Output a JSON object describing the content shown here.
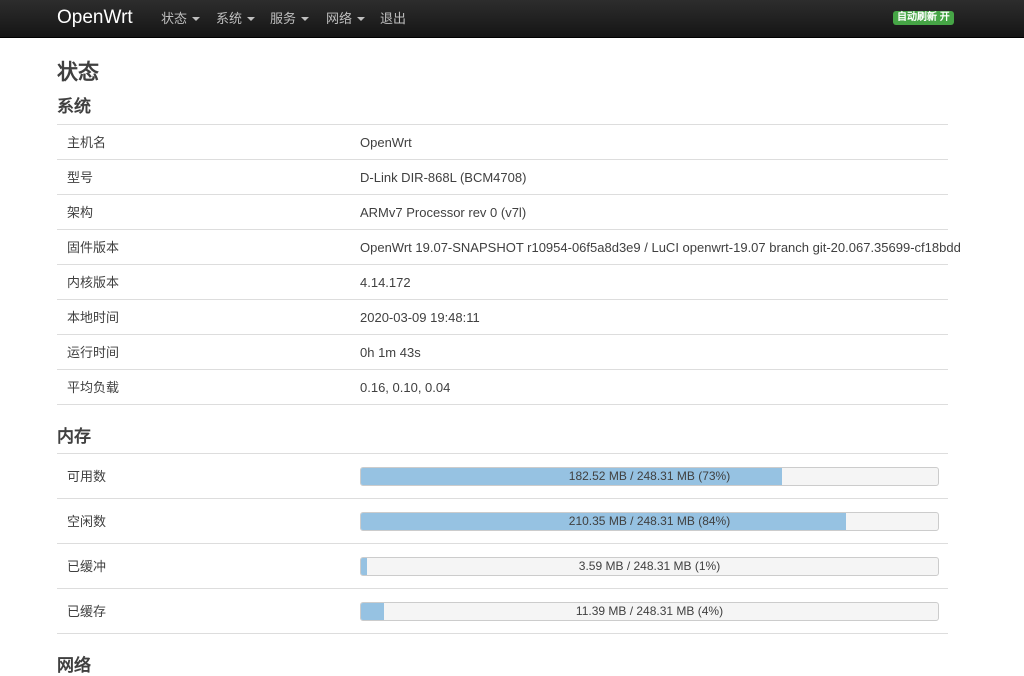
{
  "navbar": {
    "brand": "OpenWrt",
    "menu": [
      {
        "label": "状态",
        "dropdown": true
      },
      {
        "label": "系统",
        "dropdown": true
      },
      {
        "label": "服务",
        "dropdown": true
      },
      {
        "label": "网络",
        "dropdown": true
      },
      {
        "label": "退出",
        "dropdown": false
      }
    ],
    "auto_refresh": "自动刷新 开",
    "auto_refresh_color": "#46a546"
  },
  "page": {
    "title": "状态"
  },
  "system": {
    "title": "系统",
    "rows": [
      {
        "key": "主机名",
        "value": "OpenWrt"
      },
      {
        "key": "型号",
        "value": "D-Link DIR-868L (BCM4708)"
      },
      {
        "key": "架构",
        "value": "ARMv7 Processor rev 0 (v7l)"
      },
      {
        "key": "固件版本",
        "value": "OpenWrt 19.07-SNAPSHOT r10954-06f5a8d3e9 / LuCI openwrt-19.07 branch git-20.067.35699-cf18bdd"
      },
      {
        "key": "内核版本",
        "value": "4.14.172"
      },
      {
        "key": "本地时间",
        "value": "2020-03-09 19:48:11"
      },
      {
        "key": "运行时间",
        "value": "0h 1m 43s"
      },
      {
        "key": "平均负载",
        "value": "0.16, 0.10, 0.04"
      }
    ]
  },
  "memory": {
    "title": "内存",
    "bar_color": "#96c2e2",
    "rows": [
      {
        "key": "可用数",
        "text": "182.52 MB / 248.31 MB (73%)",
        "percent": 73
      },
      {
        "key": "空闲数",
        "text": "210.35 MB / 248.31 MB (84%)",
        "percent": 84
      },
      {
        "key": "已缓冲",
        "text": "3.59 MB / 248.31 MB (1%)",
        "percent": 1
      },
      {
        "key": "已缓存",
        "text": "11.39 MB / 248.31 MB (4%)",
        "percent": 4
      }
    ]
  },
  "network": {
    "title": "网络"
  }
}
